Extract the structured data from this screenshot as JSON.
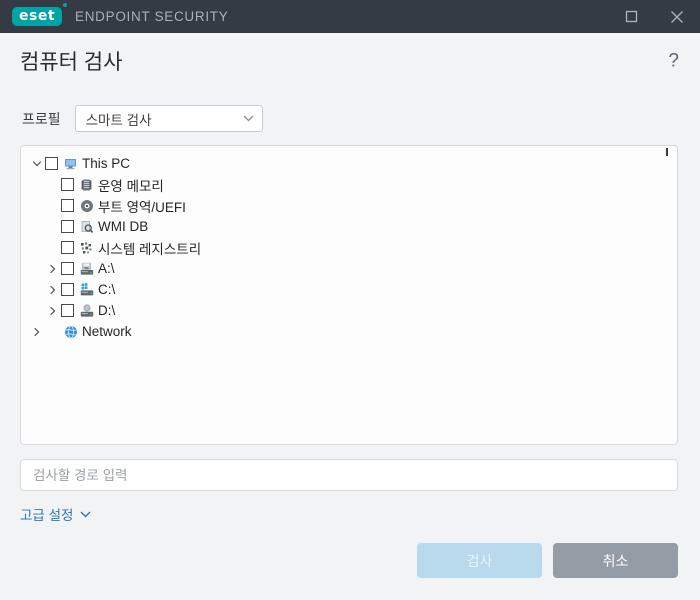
{
  "titlebar": {
    "logo_text": "eset",
    "product_name": "ENDPOINT SECURITY",
    "maximize_label": "Maximize",
    "close_label": "Close",
    "accent_color": "#00a3a8",
    "background_color": "#343b45"
  },
  "header": {
    "title": "컴퓨터 검사",
    "help_glyph": "?"
  },
  "profile": {
    "label": "프로필",
    "selected": "스마트 검사",
    "options": [
      "스마트 검사"
    ]
  },
  "tree": {
    "items": [
      {
        "label": "This PC",
        "icon": "monitor-icon",
        "indent": 1,
        "twisty": "down",
        "checkbox": true,
        "checked": false
      },
      {
        "label": "운영 메모리",
        "icon": "memory-icon",
        "indent": 2,
        "twisty": "none",
        "checkbox": true,
        "checked": false
      },
      {
        "label": "부트 영역/UEFI",
        "icon": "disc-icon",
        "indent": 2,
        "twisty": "none",
        "checkbox": true,
        "checked": false
      },
      {
        "label": "WMI DB",
        "icon": "database-icon",
        "indent": 2,
        "twisty": "none",
        "checkbox": true,
        "checked": false
      },
      {
        "label": "시스템 레지스트리",
        "icon": "registry-icon",
        "indent": 2,
        "twisty": "none",
        "checkbox": true,
        "checked": false
      },
      {
        "label": "A:\\",
        "icon": "floppy-icon",
        "indent": 2,
        "twisty": "right",
        "checkbox": true,
        "checked": false
      },
      {
        "label": "C:\\",
        "icon": "harddisk-icon",
        "indent": 2,
        "twisty": "right",
        "checkbox": true,
        "checked": false
      },
      {
        "label": "D:\\",
        "icon": "optical-icon",
        "indent": 2,
        "twisty": "right",
        "checkbox": true,
        "checked": false
      },
      {
        "label": "Network",
        "icon": "globe-icon",
        "indent": 1,
        "twisty": "right",
        "checkbox": false,
        "checked": false
      }
    ]
  },
  "path_field": {
    "value": "",
    "placeholder": "검사할 경로 입력"
  },
  "advanced": {
    "label": "고급 설정",
    "link_color": "#2a7ab0"
  },
  "footer": {
    "scan_label": "검사",
    "cancel_label": "취소",
    "scan_color": "#b9d9ed",
    "cancel_color": "#949ca6"
  }
}
